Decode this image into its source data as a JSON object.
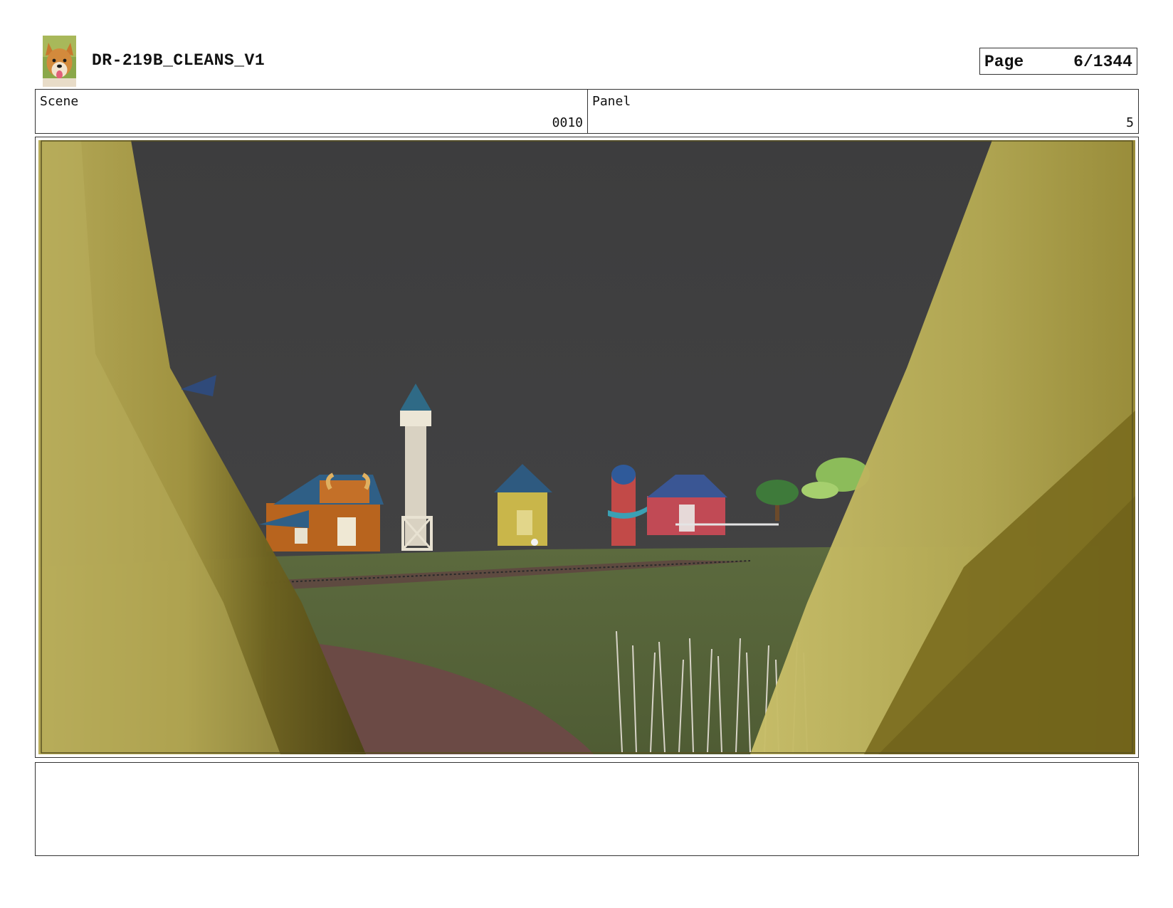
{
  "header": {
    "title": "DR-219B_CLEANS_V1",
    "page_label": "Page",
    "page_value": "6/1344",
    "logo_icon": "dog-avatar-icon"
  },
  "info": {
    "scene_label": "Scene",
    "scene_value": "0010",
    "panel_label": "Panel",
    "panel_value": "5"
  },
  "frame": {
    "sky_color": "#3f3f40",
    "grass_color": "#56633a",
    "path_color": "#6b4a45",
    "foreground_color": "#a89d45"
  },
  "notes": {
    "text": ""
  }
}
